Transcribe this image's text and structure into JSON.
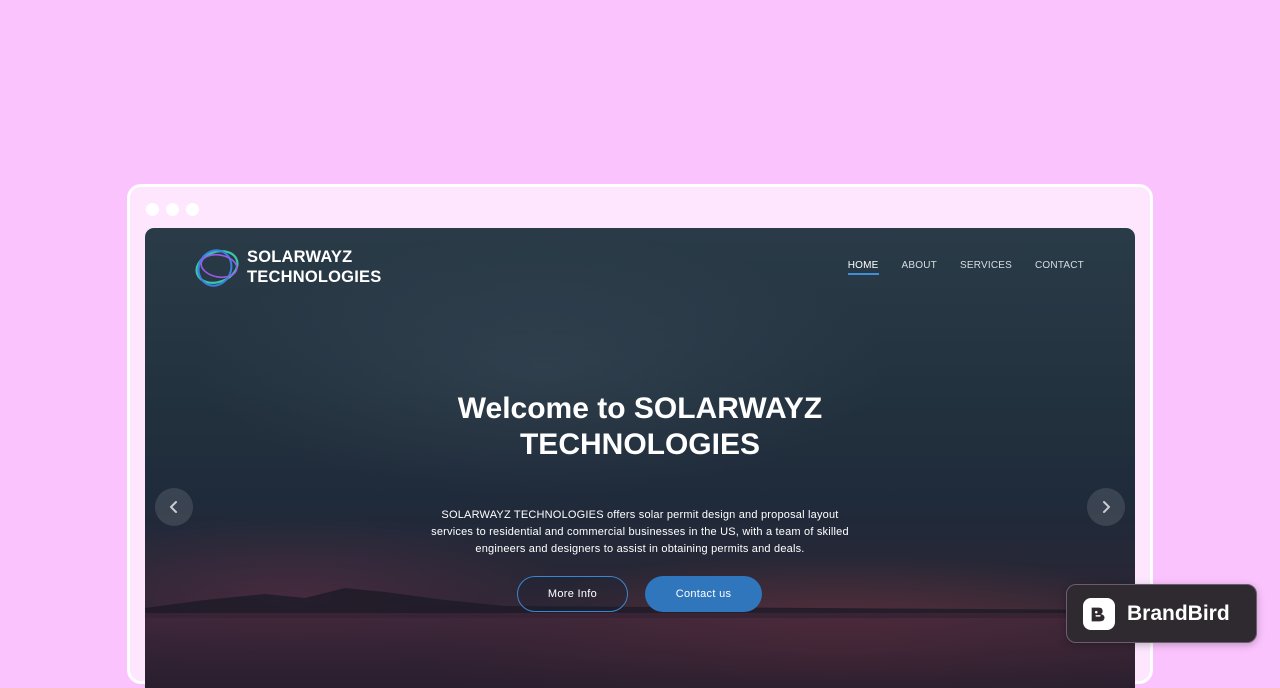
{
  "site": {
    "logo_line1": "SOLARWAYZ",
    "logo_line2": "TECHNOLOGIES",
    "nav": [
      {
        "label": "HOME",
        "active": true
      },
      {
        "label": "ABOUT",
        "active": false
      },
      {
        "label": "SERVICES",
        "active": false
      },
      {
        "label": "CONTACT",
        "active": false
      }
    ],
    "hero": {
      "title_line1": "Welcome to SOLARWAYZ",
      "title_line2": "TECHNOLOGIES",
      "description": "SOLARWAYZ TECHNOLOGIES offers solar permit design and proposal layout services to residential and commercial businesses in the US, with a team of skilled engineers and designers to assist in obtaining permits and deals.",
      "more_info_label": "More Info",
      "contact_label": "Contact us"
    }
  },
  "colors": {
    "page_background": "#fbc3fd",
    "accent_blue": "#2f76bd",
    "nav_active_underline": "#3f8fd6"
  },
  "badge": {
    "label": "BrandBird"
  }
}
